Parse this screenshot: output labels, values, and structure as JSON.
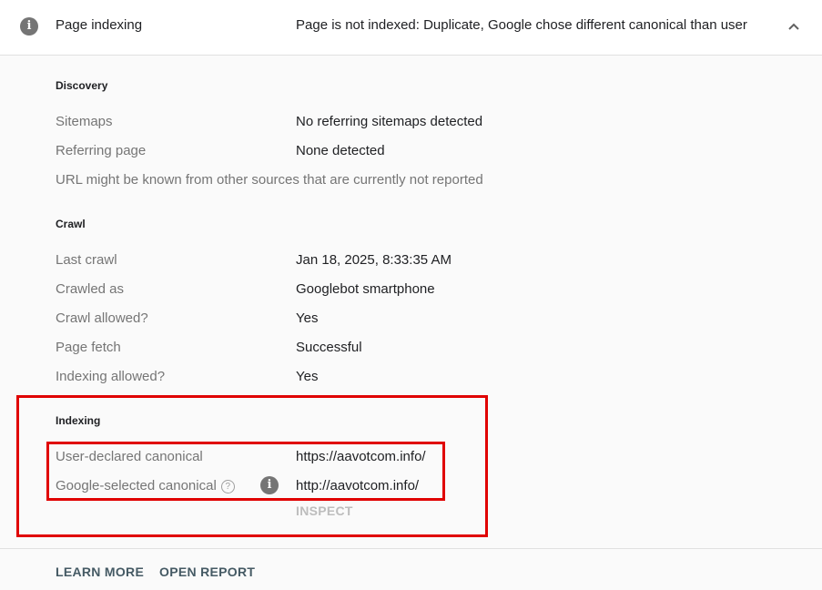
{
  "header": {
    "icon": "info-icon",
    "title": "Page indexing",
    "status": "Page is not indexed: Duplicate, Google chose different canonical than user",
    "toggle_icon": "chevron-up-icon"
  },
  "discovery": {
    "title": "Discovery",
    "rows": [
      {
        "label": "Sitemaps",
        "value": "No referring sitemaps detected"
      },
      {
        "label": "Referring page",
        "value": "None detected"
      }
    ],
    "note": "URL might be known from other sources that are currently not reported"
  },
  "crawl": {
    "title": "Crawl",
    "rows": [
      {
        "label": "Last crawl",
        "value": "Jan 18, 2025, 8:33:35 AM"
      },
      {
        "label": "Crawled as",
        "value": "Googlebot smartphone"
      },
      {
        "label": "Crawl allowed?",
        "value": "Yes"
      },
      {
        "label": "Page fetch",
        "value": "Successful"
      },
      {
        "label": "Indexing allowed?",
        "value": "Yes"
      }
    ]
  },
  "indexing": {
    "title": "Indexing",
    "rows": [
      {
        "label": "User-declared canonical",
        "value": "https://aavotcom.info/"
      },
      {
        "label": "Google-selected canonical",
        "value": "http://aavotcom.info/",
        "help_icon": "?",
        "info_icon": "i"
      }
    ],
    "inspect_label": "INSPECT"
  },
  "footer": {
    "learn_more": "LEARN MORE",
    "open_report": "OPEN REPORT"
  },
  "colors": {
    "highlight": "#e00000",
    "label": "#757575",
    "value": "#202124",
    "footer_button": "#455a64",
    "disabled": "#bdbdbd"
  }
}
